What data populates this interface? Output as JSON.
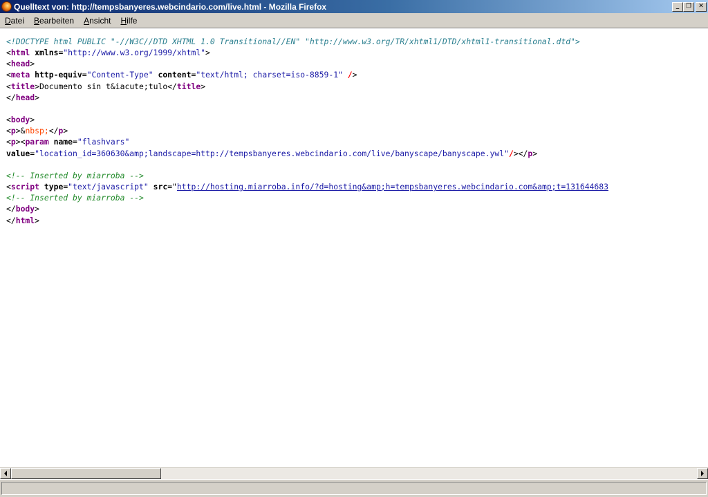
{
  "window": {
    "title": "Quelltext von: http://tempsbanyeres.webcindario.com/live.html - Mozilla Firefox",
    "buttons": {
      "minimize": "_",
      "maximize": "❐",
      "close": "✕"
    }
  },
  "menu": [
    {
      "accel": "D",
      "rest": "atei"
    },
    {
      "accel": "B",
      "rest": "earbeiten"
    },
    {
      "accel": "A",
      "rest": "nsicht"
    },
    {
      "accel": "H",
      "rest": "ilfe"
    }
  ],
  "source": {
    "doctype": "<!DOCTYPE html PUBLIC \"-//W3C//DTD XHTML 1.0 Transitional//EN\" \"http://www.w3.org/TR/xhtml1/DTD/xhtml1-transitional.dtd\">",
    "html_open": "html",
    "html_xmlns_attr": "xmlns",
    "html_xmlns_val": "\"http://www.w3.org/1999/xhtml\"",
    "head": "head",
    "meta": "meta",
    "meta_attr1": "http-equiv",
    "meta_val1": "\"Content-Type\"",
    "meta_attr2": "content",
    "meta_val2": "\"text/html; charset=iso-8859-1\"",
    "title": "title",
    "title_text": "Documento sin t&iacute;tulo",
    "body": "body",
    "p": "p",
    "nbsp_amp": "&",
    "nbsp_name": "nbsp;",
    "param": "param",
    "param_name_attr": "name",
    "param_name_val": "\"flashvars\"",
    "param_value_attr": "value",
    "param_value_val": "\"location_id=360630&amp;landscape=http://tempsbanyeres.webcindario.com/live/banyscape/banyscape.ywl\"",
    "comment": "<!-- Inserted by miarroba -->",
    "script": "script",
    "script_type_attr": "type",
    "script_type_val": "\"text/javascript\"",
    "script_src_attr": "src",
    "script_src_val": "http://hosting.miarroba.info/?d=hosting&amp;h=tempsbanyeres.webcindario.com&amp;t=131644683"
  },
  "status": {
    "text": ""
  }
}
